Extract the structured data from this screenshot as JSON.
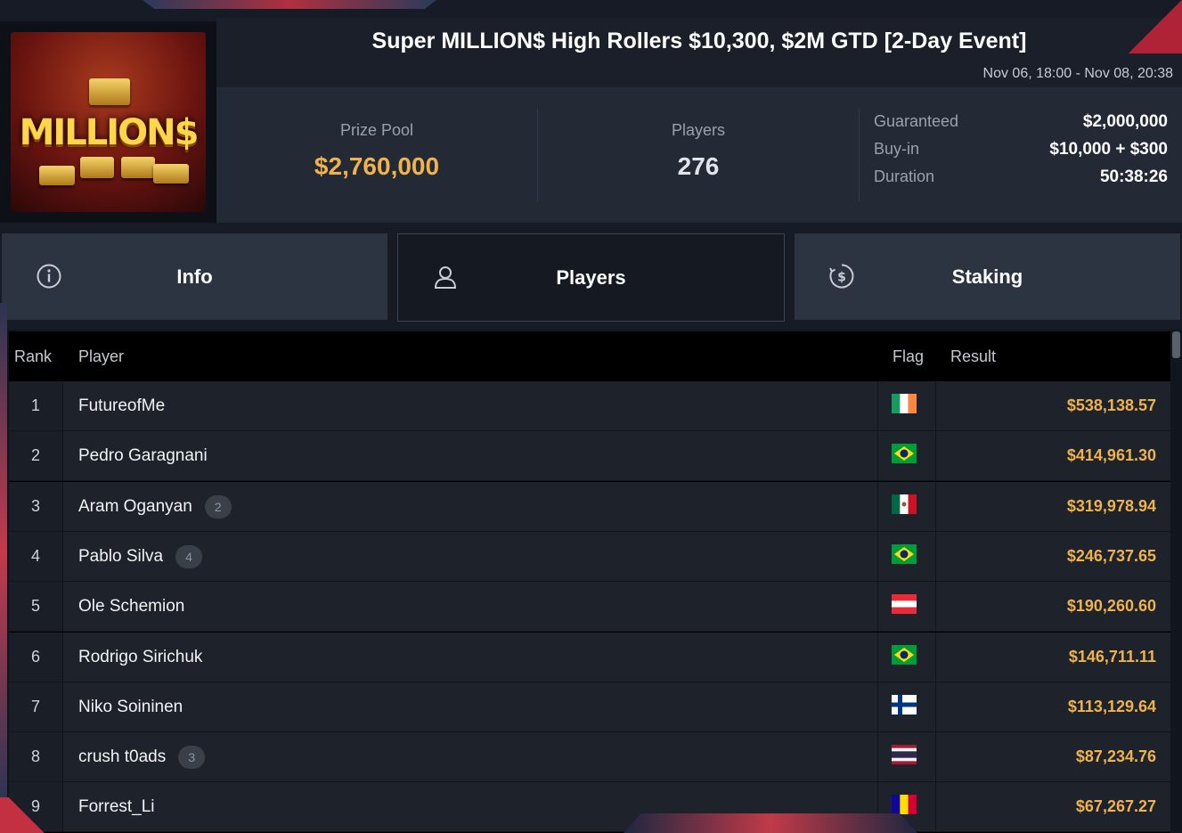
{
  "tournament": {
    "title": "Super MILLION$ High Rollers $10,300, $2M GTD [2-Day Event]",
    "dates": "Nov 06, 18:00 - Nov 08, 20:38",
    "logo_text": "MILLION$"
  },
  "stats": {
    "prize_pool_label": "Prize Pool",
    "prize_pool_value": "$2,760,000",
    "players_label": "Players",
    "players_value": "276",
    "details": [
      {
        "label": "Guaranteed",
        "value": "$2,000,000"
      },
      {
        "label": "Buy-in",
        "value": "$10,000 + $300"
      },
      {
        "label": "Duration",
        "value": "50:38:26"
      }
    ]
  },
  "tabs": [
    {
      "label": "Info",
      "icon": "info-icon",
      "active": false
    },
    {
      "label": "Players",
      "icon": "user-icon",
      "active": true
    },
    {
      "label": "Staking",
      "icon": "dollar-icon",
      "active": false
    }
  ],
  "table": {
    "headers": {
      "rank": "Rank",
      "player": "Player",
      "flag": "Flag",
      "result": "Result"
    },
    "rows": [
      {
        "rank": "1",
        "player": "FutureofMe",
        "badge": "",
        "flag": "ireland-flag",
        "result": "$538,138.57"
      },
      {
        "rank": "2",
        "player": "Pedro Garagnani",
        "badge": "",
        "flag": "brazil-flag",
        "result": "$414,961.30"
      },
      {
        "rank": "3",
        "player": "Aram Oganyan",
        "badge": "2",
        "flag": "mexico-flag",
        "result": "$319,978.94"
      },
      {
        "rank": "4",
        "player": "Pablo Silva",
        "badge": "4",
        "flag": "brazil-flag",
        "result": "$246,737.65"
      },
      {
        "rank": "5",
        "player": "Ole Schemion",
        "badge": "",
        "flag": "austria-flag",
        "result": "$190,260.60"
      },
      {
        "rank": "6",
        "player": "Rodrigo Sirichuk",
        "badge": "",
        "flag": "brazil-flag",
        "result": "$146,711.11"
      },
      {
        "rank": "7",
        "player": "Niko Soininen",
        "badge": "",
        "flag": "finland-flag",
        "result": "$113,129.64"
      },
      {
        "rank": "8",
        "player": "crush t0ads",
        "badge": "3",
        "flag": "thailand-flag",
        "result": "$87,234.76"
      },
      {
        "rank": "9",
        "player": "Forrest_Li",
        "badge": "",
        "flag": "andorra-flag",
        "result": "$67,267.27"
      }
    ]
  },
  "colors": {
    "accent_gold": "#efb24c",
    "background": "#11151d"
  }
}
